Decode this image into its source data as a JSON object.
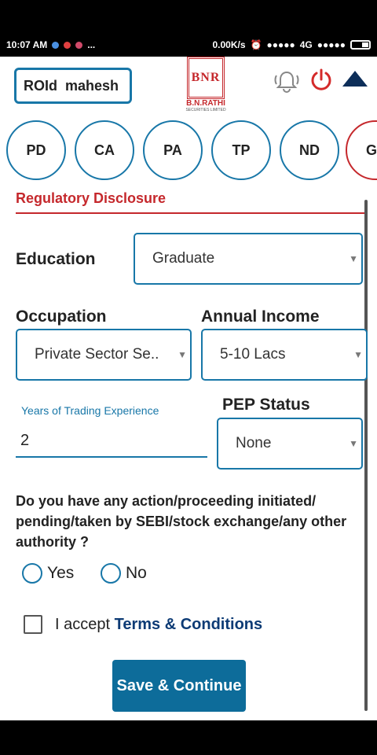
{
  "status_bar": {
    "time": "10:07 AM",
    "network_speed": "0.00K/s",
    "network_type": "4G",
    "overflow": "..."
  },
  "header": {
    "roid_label": "ROId",
    "roid_value": "mahesh",
    "logo_mark": "BNR",
    "logo_name": "B.N.RATHI",
    "logo_sub": "SECURITIES LIMITED"
  },
  "steps": [
    "PD",
    "CA",
    "PA",
    "TP",
    "ND",
    "G"
  ],
  "section": {
    "title": "Regulatory Disclosure"
  },
  "form": {
    "education_label": "Education",
    "education_value": "Graduate",
    "occupation_label": "Occupation",
    "occupation_value": "Private Sector Se..",
    "income_label": "Annual Income",
    "income_value": "5-10 Lacs",
    "years_label": "Years of Trading Experience",
    "years_value": "2",
    "pep_label": "PEP Status",
    "pep_value": "None",
    "caret": "▼",
    "question": "Do you have any action/proceeding initiated/ pending/taken by SEBI/stock exchange/any other authority ?",
    "yes_label": "Yes",
    "no_label": "No",
    "accept_text": "I accept",
    "terms_text": "Terms & Conditions",
    "save_label": "Save & Continue"
  },
  "colors": {
    "primary_blue": "#1877a8",
    "brand_red": "#c5282c",
    "button_blue": "#0d6c9a",
    "link_navy": "#0d3b75"
  }
}
